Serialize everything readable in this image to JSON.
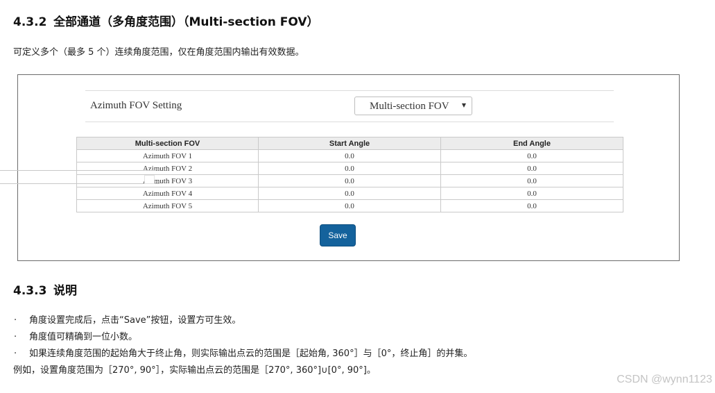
{
  "section1": {
    "number": "4.3.2",
    "title": "全部通道（多角度范围）（Multi-section FOV）"
  },
  "intro": "可定义多个（最多 5 个）连续角度范围，仅在角度范围内输出有效数据。",
  "panel": {
    "setting_label": "Azimuth FOV Setting",
    "select_value": "Multi-section FOV",
    "table": {
      "headers": [
        "Multi-section FOV",
        "Start Angle",
        "End Angle"
      ],
      "rows": [
        [
          "Azimuth FOV 1",
          "0.0",
          "0.0"
        ],
        [
          "Azimuth FOV 2",
          "0.0",
          "0.0"
        ],
        [
          "Azimuth FOV 3",
          "0.0",
          "0.0"
        ],
        [
          "Azimuth FOV 4",
          "0.0",
          "0.0"
        ],
        [
          "Azimuth FOV 5",
          "0.0",
          "0.0"
        ]
      ]
    },
    "save_label": "Save"
  },
  "section2": {
    "number": "4.3.3",
    "title": "说明"
  },
  "bullets": [
    "角度设置完成后，点击“Save”按钮，设置方可生效。",
    "角度值可精确到一位小数。",
    "如果连续角度范围的起始角大于终止角，则实际输出点云的范围是［起始角, 360°］与［0°，终止角］的并集。"
  ],
  "bullet_marker": "·",
  "example": "例如，设置角度范围为［270°, 90°］，实际输出点云的范围是［270°, 360°]∪[0°, 90°]。",
  "watermark": "CSDN @wynn1123",
  "colors": {
    "save_button": "#14629c",
    "table_header_bg": "#ececec"
  }
}
